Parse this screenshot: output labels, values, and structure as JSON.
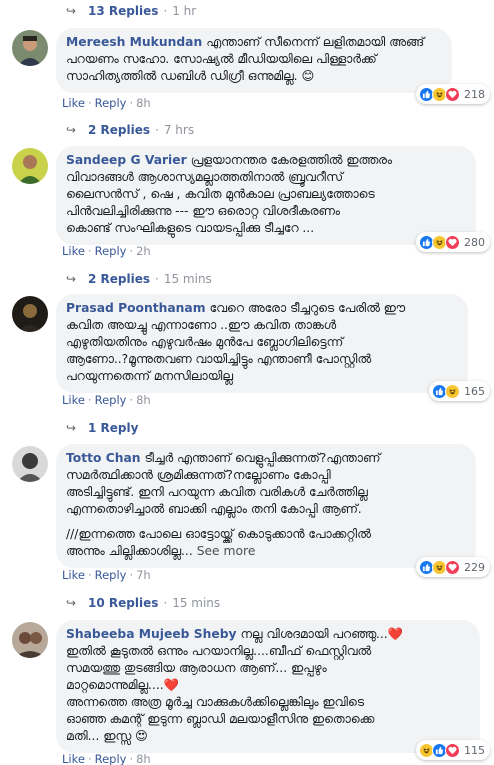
{
  "thread": [
    {
      "type": "replies",
      "count_label": "13 Replies",
      "time": "1 hr"
    },
    {
      "type": "comment",
      "author": "Mereesh Mukundan",
      "lines": [
        "എന്താണ് സീനെന്ന് ലളിതമായി അങ്ങ്",
        "പറയണം സഹോ. സോഷ്യൽ മീഡിയയിലെ പിള്ളാർക്ക്",
        "സാഹിത്യത്തിൽ ഡബിൾ ഡിഗ്രീ ഒന്നുമില്ല. 😊"
      ],
      "like": "Like",
      "reply": "Reply",
      "time": "8h",
      "reactions": [
        "like",
        "haha",
        "love"
      ],
      "reaction_count": "218"
    },
    {
      "type": "replies",
      "count_label": "2 Replies",
      "time": "7 hrs"
    },
    {
      "type": "comment",
      "author": "Sandeep G Varier",
      "lines": [
        "പ്രളയാനന്തര കേരളത്തിൽ ഇത്തരം",
        "വിവാദങ്ങൾ ആശാസ്യമല്ലാത്തതിനാൽ ബ്രൂവറീസ്",
        "ലൈസൻസ് , ഷെ , കവിത മുൻകാല പ്രാബല്യത്തോടെ",
        "പിൻവലിച്ചിരിക്കുന്നു --- ഈ ഒരൊറ്റ വിശദീകരണം",
        "കൊണ്ട് സംഘികളുടെ വായടപ്പിക്കു ടീച്ചറേ ..."
      ],
      "like": "Like",
      "reply": "Reply",
      "time": "2h",
      "reactions": [
        "like",
        "haha",
        "love"
      ],
      "reaction_count": "280"
    },
    {
      "type": "replies",
      "count_label": "2 Replies",
      "time": "15 mins"
    },
    {
      "type": "comment",
      "author": "Prasad Poonthanam",
      "lines": [
        "വേറെ അരോ ടീച്ചറുടെ പേരിൽ ഈ",
        "കവിത അയച്ചു എന്നാണോ ..ഈ കവിത താങ്കൾ",
        "എഴുതിയതിനും എഴുവർഷം മുൻപേ ബ്ലോഗിലിട്ടെന്ന്",
        "ആണോ..?മൂന്നുതവണ വായിച്ചിട്ടും എന്താണീ പോസ്റ്റിൽ",
        "പറയുന്നതെന്ന് മനസിലായില്ല"
      ],
      "like": "Like",
      "reply": "Reply",
      "time": "8h",
      "reactions": [
        "like",
        "haha"
      ],
      "reaction_count": "165"
    },
    {
      "type": "replies",
      "count_label": "1 Reply",
      "time": ""
    },
    {
      "type": "comment",
      "author": "Totto Chan",
      "lines": [
        "ടീച്ചർ എന്താണ് വെളുപ്പിക്കുന്നത്?എന്താണ്",
        "സമർത്ഥിക്കാൻ ശ്രമിക്കുന്നത്?നല്ലോണം കോപ്പി",
        "അടിച്ചിട്ടുണ്ട്. ഇനി പറയുന്ന കവിത വരികൾ ചേർത്തില്ല",
        "എന്നതൊഴിച്ചാൽ ബാക്കി എല്ലാം തനി കോപ്പി ആണ്.",
        "",
        "///ഇന്നത്തെ പോലെ ഓട്ടോയ്ക്ക് കൊടുക്കാൻ പോക്കറ്റിൽ",
        "അന്നും ചില്ലിക്കാശില്ല..."
      ],
      "see_more": "See more",
      "like": "Like",
      "reply": "Reply",
      "time": "7h",
      "reactions": [
        "like",
        "haha",
        "love"
      ],
      "reaction_count": "229"
    },
    {
      "type": "replies",
      "count_label": "10 Replies",
      "time": "15 mins"
    },
    {
      "type": "comment",
      "author": "Shabeeba Mujeeb Sheby",
      "lines": [
        "നല്ല വിശദമായി പറഞ്ഞു...❤️",
        "ഇതിൽ കൂടുതൽ ഒന്നും പറയാനില്ല....ബീഫ് ഫെസ്റ്റിവൽ",
        "സമയത്തു തുടങ്ങിയ ആരാധന ആണ്... ഇപ്പഴും",
        "മാറ്റമൊന്നുമില്ല....❤️",
        "അന്നത്തെ അത്ര മൂർച്ച വാക്കുകൾക്കില്ലെങ്കിലും ഇവിടെ",
        "ഓഞ്ഞ കമന്റ് ഇടുന്ന ബ്ലാഡി മലയാളീസിനു ഇതൊക്കെ",
        "മതി... ഇസ്സ 😍"
      ],
      "like": "Like",
      "reply": "Reply",
      "time": "8h",
      "reactions": [
        "haha",
        "like",
        "love"
      ],
      "reaction_count": "115"
    }
  ]
}
